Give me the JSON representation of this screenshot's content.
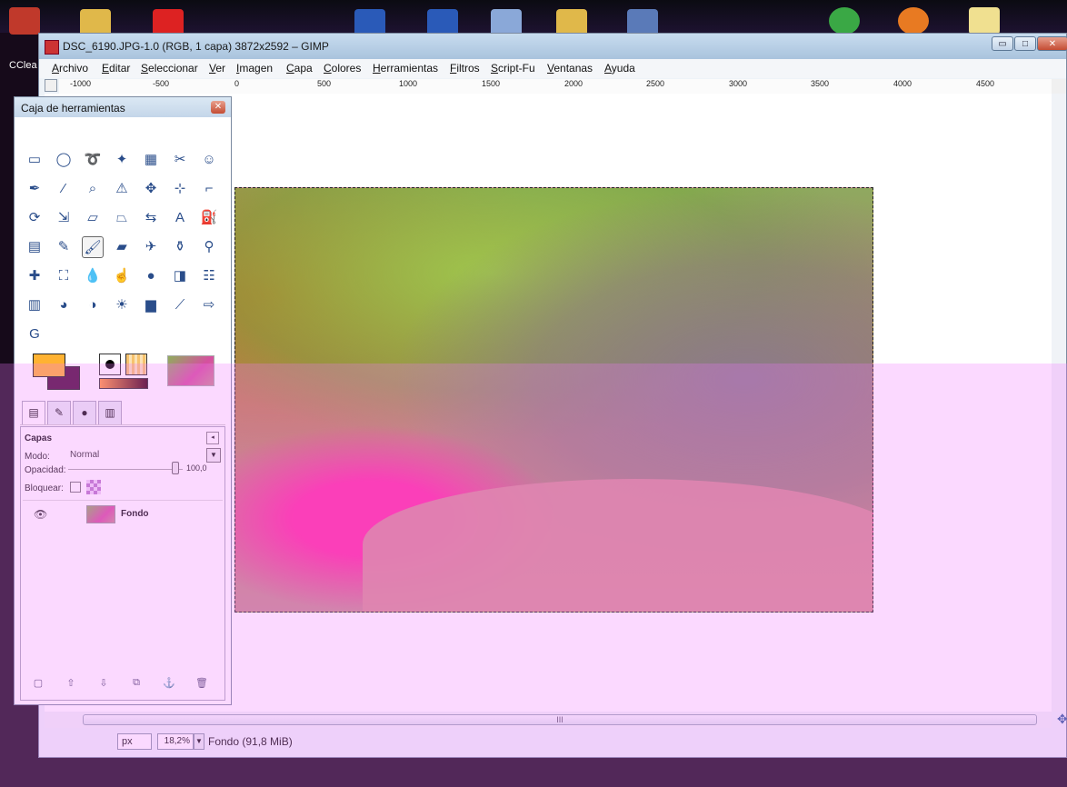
{
  "desktop": {
    "left_label": "CClea"
  },
  "image_window": {
    "title": "DSC_6190.JPG-1.0 (RGB, 1 capa) 3872x2592 – GIMP",
    "buttons": {
      "minimize": "▭",
      "maximize": "□",
      "close": "✕"
    },
    "menu": [
      {
        "label": "Archivo",
        "accel": "A",
        "rest": "rchivo"
      },
      {
        "label": "Editar",
        "accel": "E",
        "rest": "ditar"
      },
      {
        "label": "Seleccionar",
        "accel": "S",
        "rest": "eleccionar"
      },
      {
        "label": "Ver",
        "accel": "V",
        "rest": "er"
      },
      {
        "label": "Imagen",
        "accel": "I",
        "rest": "magen"
      },
      {
        "label": "Capa",
        "accel": "C",
        "rest": "apa"
      },
      {
        "label": "Colores",
        "accel": "C",
        "rest": "olores"
      },
      {
        "label": "Herramientas",
        "accel": "H",
        "rest": "erramientas"
      },
      {
        "label": "Filtros",
        "accel": "F",
        "rest": "iltros"
      },
      {
        "label": "Script-Fu",
        "accel": "S",
        "rest": "cript-Fu"
      },
      {
        "label": "Ventanas",
        "accel": "V",
        "rest": "entanas"
      },
      {
        "label": "Ayuda",
        "accel": "A",
        "rest": "yuda"
      }
    ],
    "ruler_labels": [
      "-1000",
      "-500",
      "0",
      "500",
      "1000",
      "1500",
      "2000",
      "2500",
      "3000",
      "3500",
      "4000",
      "4500"
    ],
    "scroll_grip": "III",
    "status": {
      "unit": "px",
      "zoom": "18,2%",
      "text": "Fondo (91,8 MiB)"
    }
  },
  "toolbox": {
    "title": "Caja de herramientas",
    "close": "✕",
    "tools": [
      {
        "name": "rect-select-icon",
        "glyph": "▭"
      },
      {
        "name": "ellipse-select-icon",
        "glyph": "◯"
      },
      {
        "name": "free-select-icon",
        "glyph": "➰"
      },
      {
        "name": "fuzzy-select-icon",
        "glyph": "✦"
      },
      {
        "name": "color-select-icon",
        "glyph": "▦"
      },
      {
        "name": "scissors-select-icon",
        "glyph": "✂"
      },
      {
        "name": "foreground-select-icon",
        "glyph": "☺"
      },
      {
        "name": "paths-icon",
        "glyph": "✒"
      },
      {
        "name": "color-picker-icon",
        "glyph": "⁄"
      },
      {
        "name": "zoom-icon",
        "glyph": "⌕"
      },
      {
        "name": "measure-icon",
        "glyph": "⚠"
      },
      {
        "name": "move-icon",
        "glyph": "✥"
      },
      {
        "name": "align-icon",
        "glyph": "⊹"
      },
      {
        "name": "crop-icon",
        "glyph": "⌐"
      },
      {
        "name": "rotate-icon",
        "glyph": "⟳"
      },
      {
        "name": "scale-icon",
        "glyph": "⇲"
      },
      {
        "name": "shear-icon",
        "glyph": "▱"
      },
      {
        "name": "perspective-icon",
        "glyph": "⏢"
      },
      {
        "name": "flip-icon",
        "glyph": "⇆"
      },
      {
        "name": "text-icon",
        "glyph": "A"
      },
      {
        "name": "bucket-fill-icon",
        "glyph": "⛽"
      },
      {
        "name": "blend-icon",
        "glyph": "▤"
      },
      {
        "name": "pencil-icon",
        "glyph": "✎"
      },
      {
        "name": "paintbrush-icon",
        "glyph": "🖌"
      },
      {
        "name": "eraser-icon",
        "glyph": "▰"
      },
      {
        "name": "airbrush-icon",
        "glyph": "✈"
      },
      {
        "name": "ink-icon",
        "glyph": "⚱"
      },
      {
        "name": "clone-icon",
        "glyph": "⚲"
      },
      {
        "name": "heal-icon",
        "glyph": "✚"
      },
      {
        "name": "perspective-clone-icon",
        "glyph": "⛶"
      },
      {
        "name": "blur-icon",
        "glyph": "💧"
      },
      {
        "name": "smudge-icon",
        "glyph": "☝"
      },
      {
        "name": "dodge-burn-icon",
        "glyph": "●"
      },
      {
        "name": "levels-icon",
        "glyph": "◨"
      },
      {
        "name": "curves-icon",
        "glyph": "☷"
      },
      {
        "name": "color-balance-icon",
        "glyph": "▥"
      },
      {
        "name": "hue-saturation-icon",
        "glyph": "◕"
      },
      {
        "name": "threshold-icon",
        "glyph": "◑"
      },
      {
        "name": "brightness-contrast-icon",
        "glyph": "☀"
      },
      {
        "name": "histogram-icon",
        "glyph": "▆"
      },
      {
        "name": "color-curves-icon",
        "glyph": "⟋"
      },
      {
        "name": "layer-arrange-icon",
        "glyph": "⇨"
      },
      {
        "name": "gegl-icon",
        "glyph": "G"
      }
    ]
  },
  "layers": {
    "title": "Capas",
    "mode_label": "Modo:",
    "mode_value": "Normal",
    "opacity_label": "Opacidad:",
    "opacity_value": "100,0",
    "opacity": 1.0,
    "lock_label": "Bloquear:",
    "layer_name": "Fondo",
    "menu_arrow": "◂",
    "dropdown_arrow": "▼"
  },
  "colors": {
    "foreground": "#ffb232",
    "background": "#4a0a3a",
    "accent": "#2a4d8a"
  }
}
